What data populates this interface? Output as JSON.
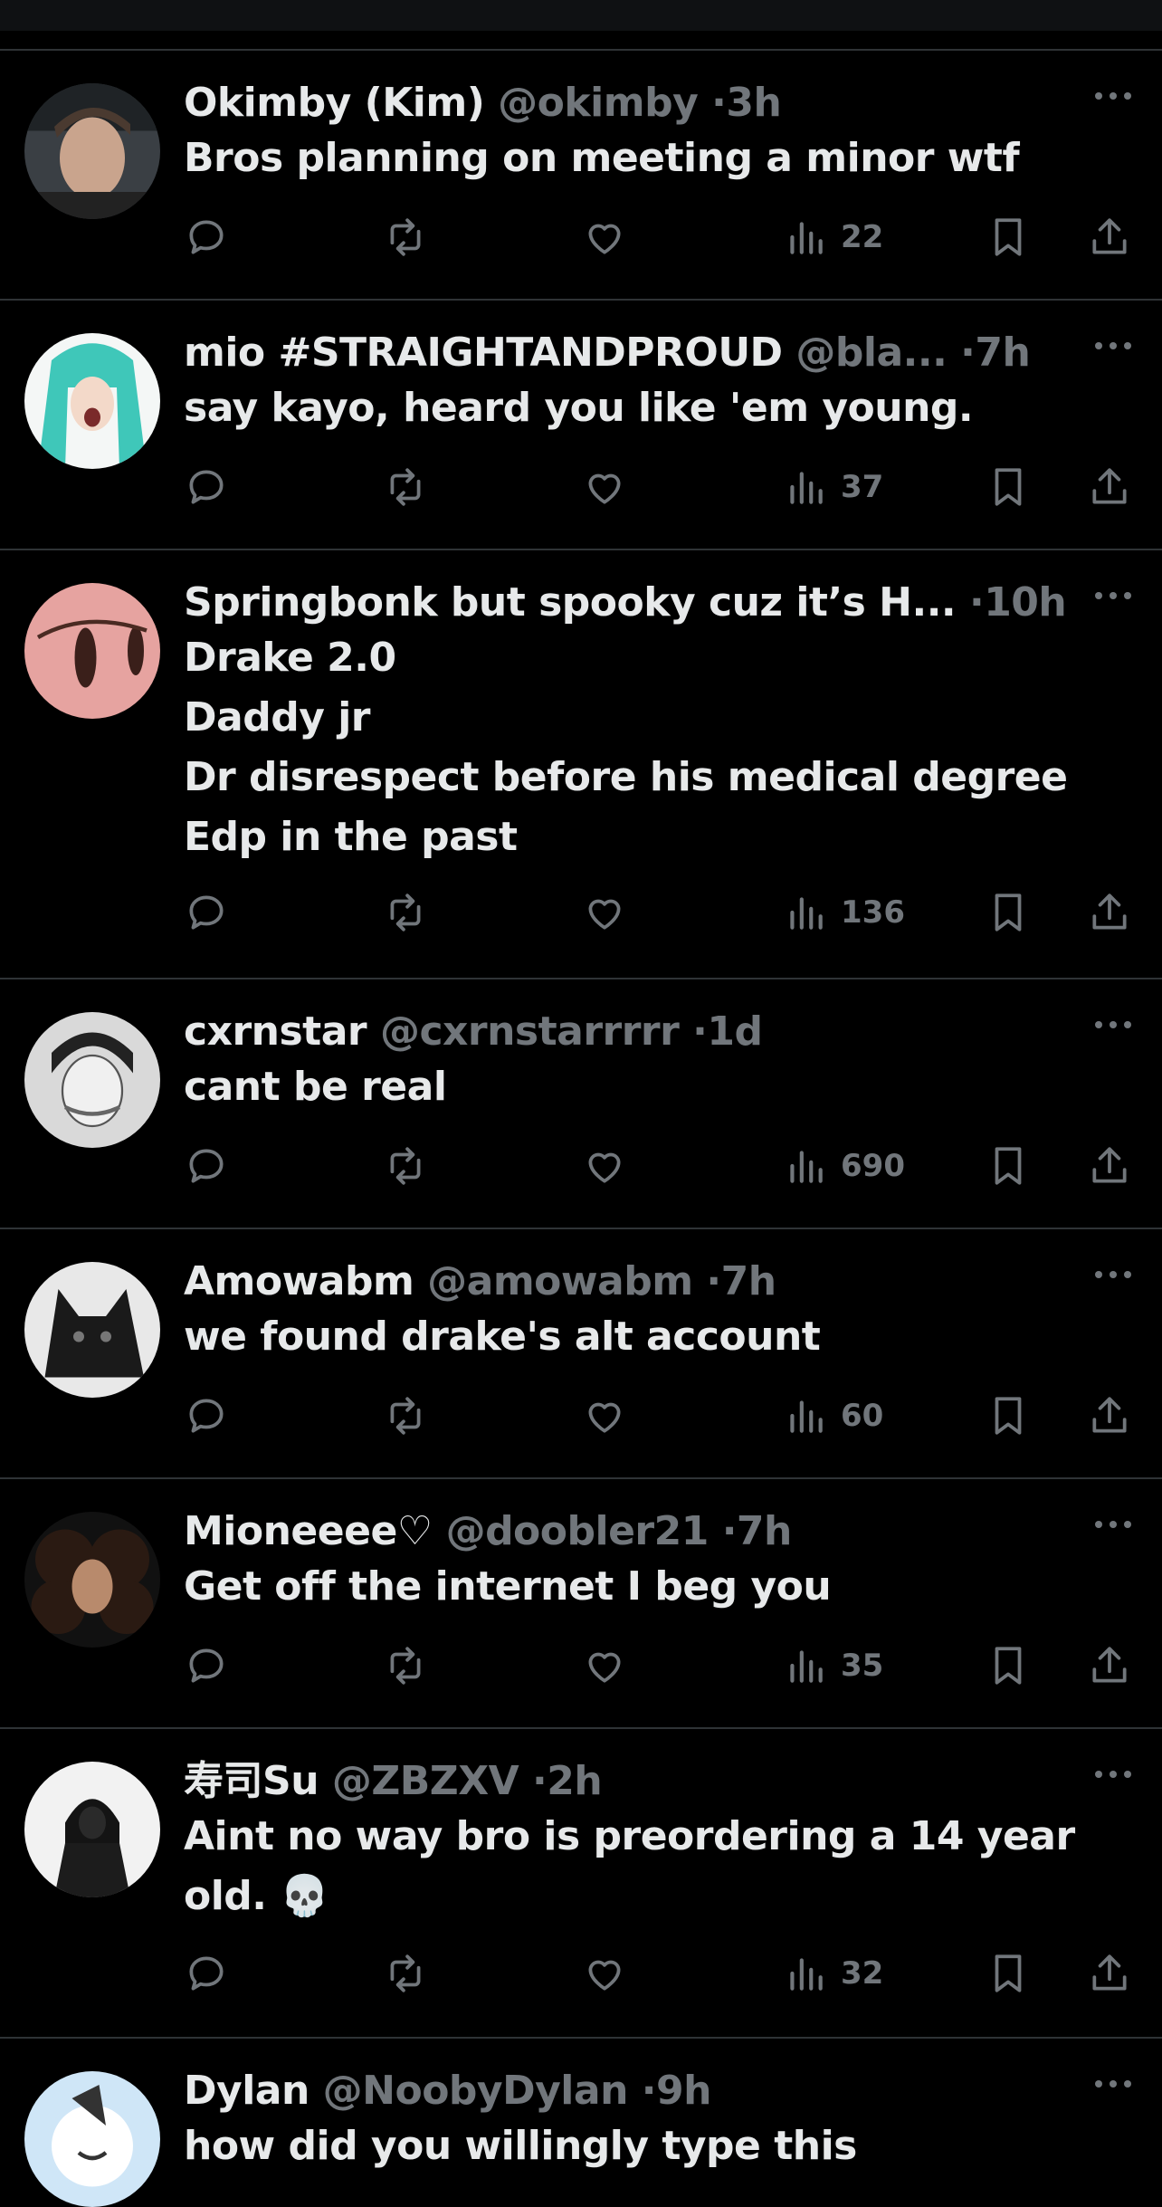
{
  "posts": [
    {
      "name": "Okimby (Kim)",
      "handle": "@okimby",
      "time": "3h",
      "lines": [
        "Bros planning on meeting a minor wtf"
      ],
      "views": "22",
      "avatar_icon": "avatar-photo-man"
    },
    {
      "name": "mio #STRAIGHTANDPROUD",
      "handle": "@bla...",
      "time": "7h",
      "lines": [
        "say kayo, heard you like 'em young."
      ],
      "views": "37",
      "avatar_icon": "avatar-anime-teal-hair"
    },
    {
      "name": "Springbonk but spooky cuz it’s H...",
      "handle": "",
      "time": "10h",
      "lines": [
        "Drake 2.0",
        "Daddy jr",
        "Dr disrespect before his medical degree",
        "Edp in the past"
      ],
      "views": "136",
      "avatar_icon": "avatar-pink-figures"
    },
    {
      "name": "cxrnstar",
      "handle": "@cxrnstarrrrr",
      "time": "1d",
      "lines": [
        "cant be real"
      ],
      "views": "690",
      "avatar_icon": "avatar-anime-sketch"
    },
    {
      "name": "Amowabm",
      "handle": "@amowabm",
      "time": "7h",
      "lines": [
        "we found drake's alt account"
      ],
      "views": "60",
      "avatar_icon": "avatar-dark-wolf"
    },
    {
      "name": "Mioneeee♡",
      "handle": "@doobler21",
      "time": "7h",
      "lines": [
        "Get off the internet I beg you"
      ],
      "views": "35",
      "avatar_icon": "avatar-curly-hair"
    },
    {
      "name": "寿司Su",
      "handle": "@ZBZXV",
      "time": "2h",
      "lines": [
        "Aint no way bro is preordering a 14 year",
        "old. 💀"
      ],
      "views": "32",
      "avatar_icon": "avatar-hooded-figure"
    },
    {
      "name": "Dylan",
      "handle": "@NoobyDylan",
      "time": "9h",
      "lines": [
        "how did you willingly type this"
      ],
      "views": "",
      "avatar_icon": "avatar-cartoon-blue"
    }
  ],
  "meta_separator": "·",
  "colors": {
    "background": "#000000",
    "text": "#e7e9ea",
    "muted": "#71767b",
    "divider": "#2f3336"
  }
}
